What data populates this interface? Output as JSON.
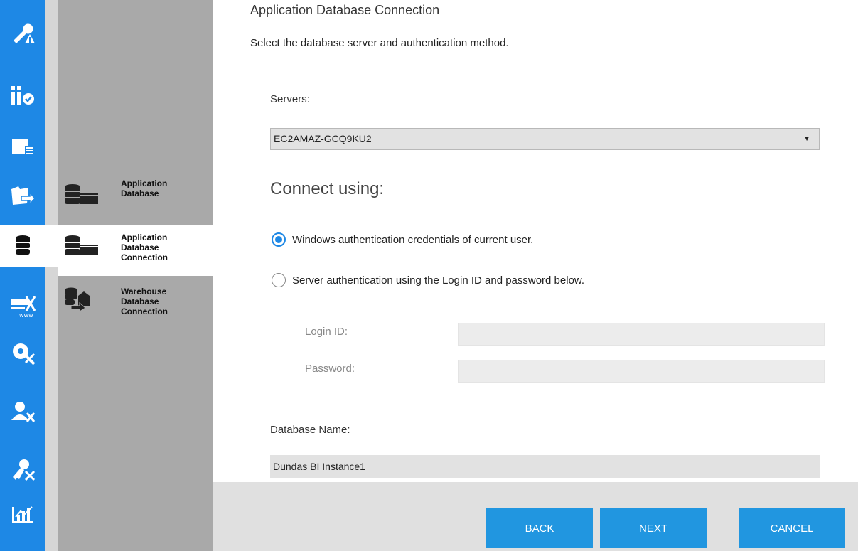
{
  "header": {
    "title": "Application Database Connection",
    "subtitle": "Select the database server and authentication method."
  },
  "rail": {
    "items": [
      {
        "icon": "wrench-warning-icon"
      },
      {
        "icon": "validation-check-icon"
      },
      {
        "icon": "layout-list-icon"
      },
      {
        "icon": "folder-move-icon"
      },
      {
        "icon": "database-icon"
      },
      {
        "icon": "web-tools-icon"
      },
      {
        "icon": "gear-tools-icon"
      },
      {
        "icon": "user-tools-icon"
      },
      {
        "icon": "key-tools-icon"
      },
      {
        "icon": "chart-icon"
      }
    ],
    "active_index": 4,
    "color": "#1e88e5"
  },
  "steps": [
    {
      "label_lines": [
        "Application",
        "Database"
      ],
      "icon": "database-server-icon"
    },
    {
      "label_lines": [
        "Application",
        "Database",
        "Connection"
      ],
      "icon": "database-server-icon",
      "active": true
    },
    {
      "label_lines": [
        "Warehouse",
        "Database",
        "Connection"
      ],
      "icon": "warehouse-transfer-icon"
    }
  ],
  "form": {
    "servers_label": "Servers:",
    "server_value": "EC2AMAZ-GCQ9KU2",
    "connect_heading": "Connect using:",
    "auth_windows": "Windows authentication credentials of current user.",
    "auth_server": "Server authentication using the Login ID and password below.",
    "auth_selected": "windows",
    "login_label": "Login ID:",
    "login_value": "",
    "password_label": "Password:",
    "password_value": "",
    "dbname_label": "Database Name:",
    "dbname_value": "Dundas BI Instance1"
  },
  "footer": {
    "back": "BACK",
    "next": "NEXT",
    "cancel": "CANCEL"
  },
  "colors": {
    "accent": "#1e88e5",
    "button": "#2196e0",
    "step_panel": "#a9a9a9"
  }
}
